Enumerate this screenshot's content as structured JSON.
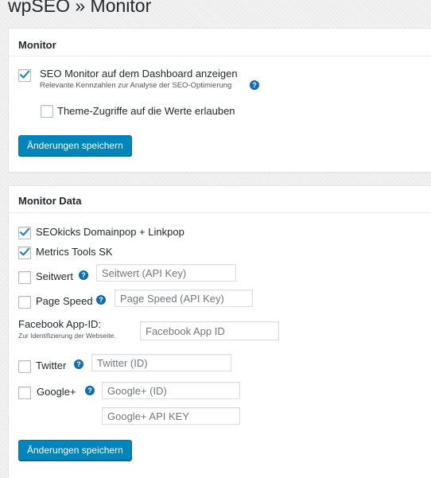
{
  "page": {
    "title": "wpSEO » Monitor"
  },
  "monitor": {
    "title": "Monitor",
    "dashboard_option": {
      "label": "SEO Monitor auf dem Dashboard anzeigen",
      "description": "Relevante Kennzahlen zur Analyse der SEO-Optimierung",
      "checked": true,
      "help_icon": "?"
    },
    "theme_option": {
      "label": "Theme-Zugriffe auf die Werte erlauben",
      "checked": false
    },
    "save_label": "Änderungen speichern"
  },
  "monitor_data": {
    "title": "Monitor Data",
    "seokicks": {
      "label": "SEOkicks Domainpop + Linkpop",
      "checked": true
    },
    "metrics": {
      "label": "Metrics Tools SK",
      "checked": true
    },
    "seitwert": {
      "label": "Seitwert",
      "checked": false,
      "help_icon": "?",
      "placeholder": "Seitwert (API Key)",
      "value": ""
    },
    "pagespeed": {
      "label": "Page Speed",
      "checked": false,
      "help_icon": "?",
      "placeholder": "Page Speed (API Key)",
      "value": ""
    },
    "facebook": {
      "label": "Facebook App-ID:",
      "description": "Zur Identifizierung der Webseite.",
      "placeholder": "Facebook App ID",
      "value": ""
    },
    "twitter": {
      "label": "Twitter",
      "checked": false,
      "help_icon": "?",
      "placeholder": "Twitter (ID)",
      "value": ""
    },
    "google": {
      "label": "Google+",
      "checked": false,
      "help_icon": "?",
      "placeholder_id": "Google+ (ID)",
      "placeholder_key": "Google+ API KEY",
      "value": ""
    },
    "save_label": "Änderungen speichern"
  },
  "colors": {
    "accent": "#0085ba",
    "help": "#0f6eb0",
    "check": "#1e8cbe"
  },
  "icons": {
    "checkmark": "checkmark-icon",
    "help": "help-icon"
  }
}
